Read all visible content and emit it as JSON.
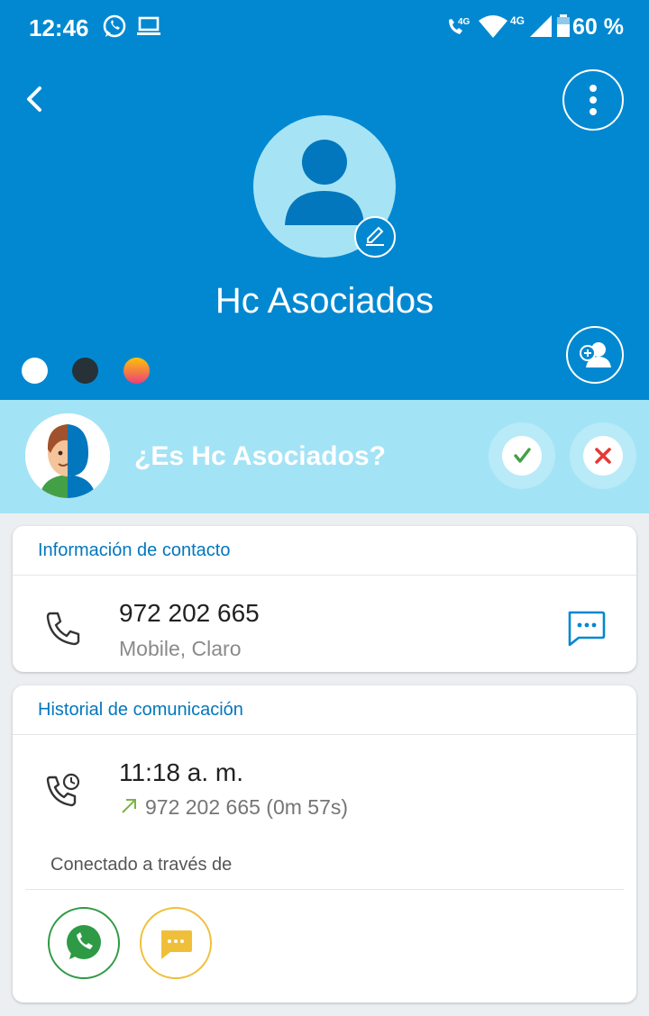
{
  "status_bar": {
    "time": "12:46",
    "left_icons": [
      "whatsapp-icon",
      "laptop-icon"
    ],
    "right_icons": [
      "volte-call-icon",
      "wifi-icon",
      "cellular-4g-icon",
      "battery-icon"
    ],
    "network_label": "4G",
    "call_network_label": "4G",
    "battery": "60 %"
  },
  "header": {
    "back_icon": "chevron-left-icon",
    "menu_icon": "more-vert-icon",
    "contact_name": "Hc Asociados",
    "edit_icon": "pencil-icon",
    "add_contact_icon": "add-person-icon",
    "theme_dots": [
      "#ffffff",
      "#263238",
      "gradient-orange-pink"
    ],
    "background_color": "#0288d1"
  },
  "suggestion": {
    "question": "¿Es Hc Asociados?",
    "confirm_icon": "check-icon",
    "reject_icon": "close-icon",
    "confirm_color": "#43a047",
    "reject_color": "#e53935"
  },
  "contact_info": {
    "title": "Información de contacto",
    "phone": "972 202 665",
    "detail": "Mobile, Claro",
    "phone_icon": "phone-icon",
    "message_icon": "message-icon"
  },
  "history": {
    "title": "Historial de comunicación",
    "time": "11:18 a. m.",
    "call_detail": "972 202 665 (0m 57s)",
    "history_icon": "call-history-icon",
    "direction_icon": "outgoing-arrow-icon",
    "connected_label": "Conectado a través de",
    "apps": [
      {
        "name": "whatsapp",
        "icon": "whatsapp-icon",
        "color": "#2e9a45"
      },
      {
        "name": "sms",
        "icon": "sms-icon",
        "color": "#f0bf3a"
      }
    ]
  }
}
